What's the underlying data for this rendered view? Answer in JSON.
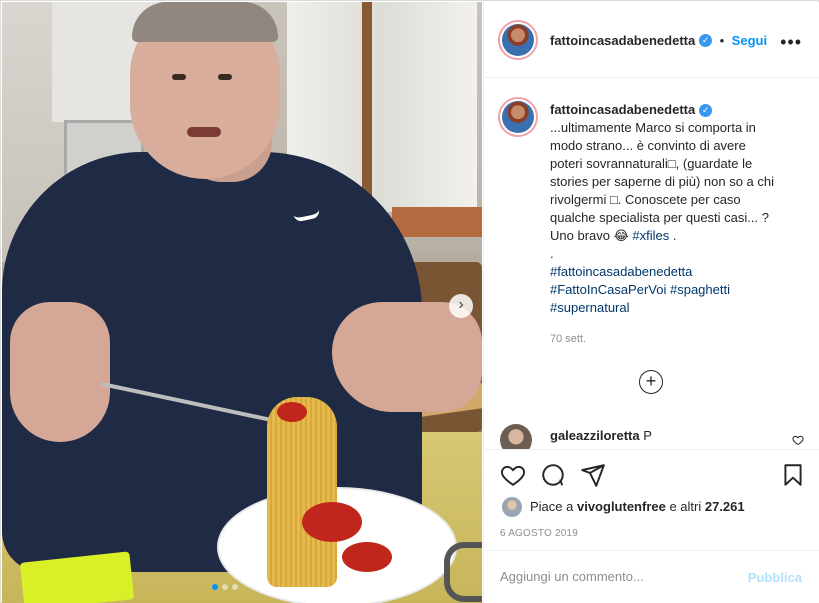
{
  "post": {
    "author": "fattoincasadabenedetta",
    "follow_separator": "•",
    "follow_label": "Segui",
    "more_label": "•••",
    "caption_author": "fattoincasadabenedetta",
    "caption_lines": [
      "...ultimamente Marco si comporta in",
      "modo strano... è convinto di avere",
      "poteri sovrannaturali□, (guardate le",
      "stories per saperne di più) non so a chi",
      "rivolgermi □. Conoscete per caso",
      "qualche specialista per questi casi... ?",
      "Uno bravo 😂"
    ],
    "caption_inline_tag": "#xfiles",
    "caption_tail": " .",
    "caption_dot": ".",
    "hashtags": [
      "#fattoincasadabenedetta",
      "#FattoInCasaPerVoi",
      "#spaghetti",
      "#supernatural"
    ],
    "time_ago": "70 sett.",
    "load_more_label": "+"
  },
  "comment": {
    "user": "galeazziloretta",
    "text": "P"
  },
  "likes": {
    "prefix": "Piace a ",
    "user": "vivoglutenfree",
    "middle": " e altri ",
    "count": "27.261"
  },
  "date": "6 AGOSTO 2019",
  "add_comment": {
    "placeholder": "Aggiungi un commento...",
    "publish_label": "Pubblica"
  },
  "carousel": {
    "next_label": "›",
    "slide_count": 3,
    "active_index": 0
  },
  "icons": [
    "heart-icon",
    "comment-icon",
    "share-icon",
    "bookmark-icon",
    "verified-icon",
    "plus-circle-icon",
    "chevron-right-icon"
  ],
  "colors": {
    "link": "#0095f6",
    "hashtag": "#00376b",
    "muted": "#8e8e8e",
    "verified": "#3897f0"
  }
}
